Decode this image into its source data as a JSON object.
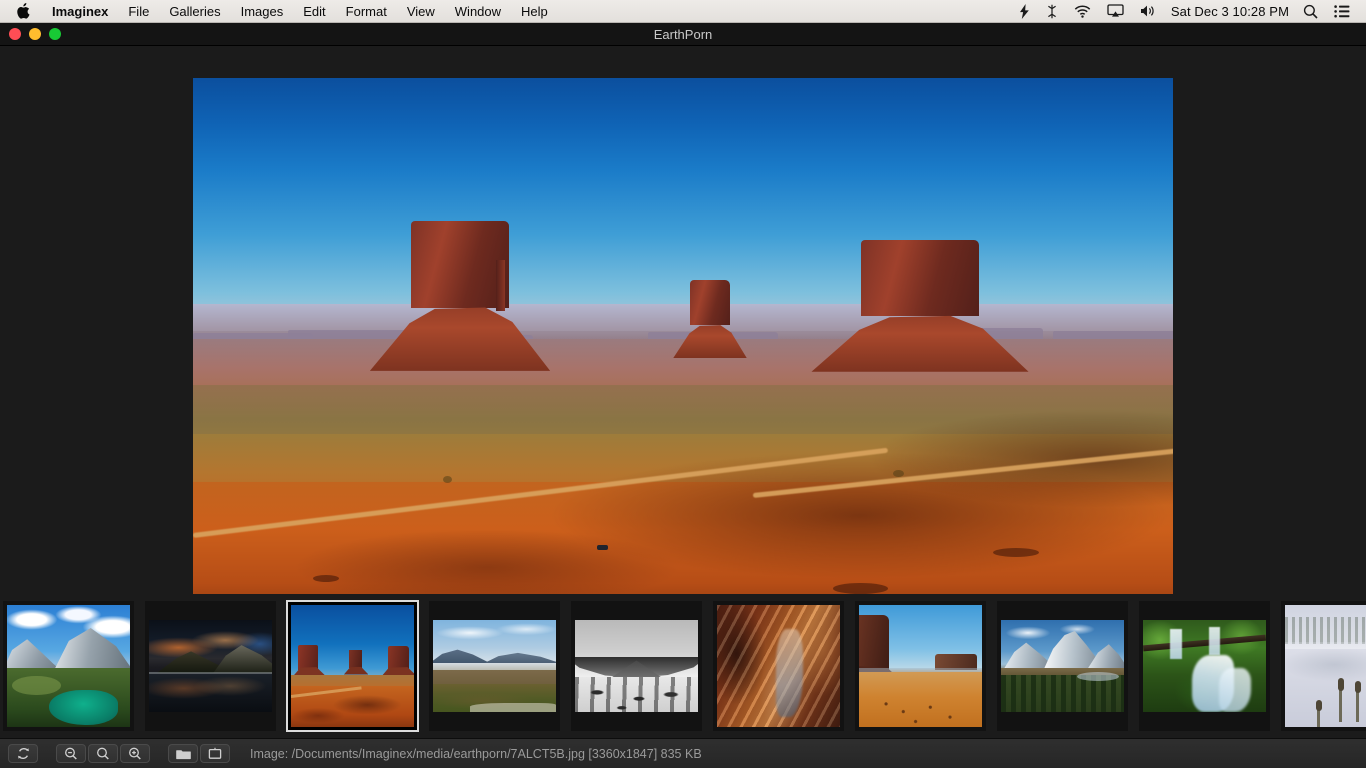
{
  "menubar": {
    "apple_icon": "apple-logo-icon",
    "app_name": "Imaginex",
    "items": [
      {
        "label": "File",
        "name": "menu-file"
      },
      {
        "label": "Galleries",
        "name": "menu-galleries"
      },
      {
        "label": "Images",
        "name": "menu-images"
      },
      {
        "label": "Edit",
        "name": "menu-edit"
      },
      {
        "label": "Format",
        "name": "menu-format"
      },
      {
        "label": "View",
        "name": "menu-view"
      },
      {
        "label": "Window",
        "name": "menu-window"
      },
      {
        "label": "Help",
        "name": "menu-help"
      }
    ],
    "status_icons": [
      {
        "name": "flash-bolt-icon"
      },
      {
        "name": "bluetooth-icon"
      },
      {
        "name": "wifi-icon"
      },
      {
        "name": "airplay-icon"
      },
      {
        "name": "volume-icon"
      }
    ],
    "clock": "Sat Dec 3  10:28 PM",
    "search_icon": "spotlight-search-icon",
    "notification_icon": "notification-center-icon"
  },
  "window": {
    "title": "EarthPorn",
    "close_label": "",
    "minimize_label": "",
    "maximize_label": ""
  },
  "viewer": {
    "image_alt": "Monument Valley buttes under deep blue sky with red desert floor and dirt road"
  },
  "thumbnails": [
    {
      "name": "thumbnail-alpine-lake-valley",
      "caption": "alpine valley with turquoise lake",
      "selected": false
    },
    {
      "name": "thumbnail-dark-mountain-reflection",
      "caption": "dark mountain sunset reflected in lake",
      "selected": false
    },
    {
      "name": "thumbnail-monument-valley",
      "caption": "Monument Valley red buttes",
      "selected": true
    },
    {
      "name": "thumbnail-snowy-farm-valley",
      "caption": "snow dusted valley town and fields",
      "selected": false
    },
    {
      "name": "thumbnail-bw-snow-crater",
      "caption": "black and white snowy crater",
      "selected": false
    },
    {
      "name": "thumbnail-slot-canyon",
      "caption": "orange slot canyon walls",
      "selected": false
    },
    {
      "name": "thumbnail-desert-mesa",
      "caption": "desert mesa under pale blue sky",
      "selected": false
    },
    {
      "name": "thumbnail-teton-mountains",
      "caption": "snowy Teton range above pine forest",
      "selected": false
    },
    {
      "name": "thumbnail-mossy-waterfall",
      "caption": "green mossy cascading waterfall",
      "selected": false
    },
    {
      "name": "thumbnail-misty-lake-cattails",
      "caption": "misty lake with frosted cattails",
      "selected": false
    }
  ],
  "toolbar": {
    "buttons": [
      {
        "name": "rotate-button",
        "icon": "rotate-icon",
        "label": ""
      },
      {
        "name": "zoom-out-button",
        "icon": "magnifier-minus-icon",
        "label": ""
      },
      {
        "name": "zoom-fit-button",
        "icon": "magnifier-icon",
        "label": ""
      },
      {
        "name": "zoom-in-button",
        "icon": "magnifier-plus-icon",
        "label": ""
      },
      {
        "name": "open-folder-button",
        "icon": "folder-icon",
        "label": ""
      },
      {
        "name": "slideshow-button",
        "icon": "presentation-screen-icon",
        "label": ""
      }
    ],
    "status": "Image: /Documents/Imaginex/media/earthporn/7ALCT5B.jpg [3360x1847] 835 KB"
  },
  "colors": {
    "menubar_bg": "#eeebe8",
    "window_bg": "#1b1b1b",
    "titlebar_bg": "#141414",
    "toolbar_bg": "#2f2f2f",
    "status_text": "#9a9a9a",
    "title_text": "#c9c9c9",
    "selection_outline": "#dcdcdc",
    "traffic_red": "#ff4d55",
    "traffic_amber": "#ffbd2e",
    "traffic_green": "#18c935"
  }
}
